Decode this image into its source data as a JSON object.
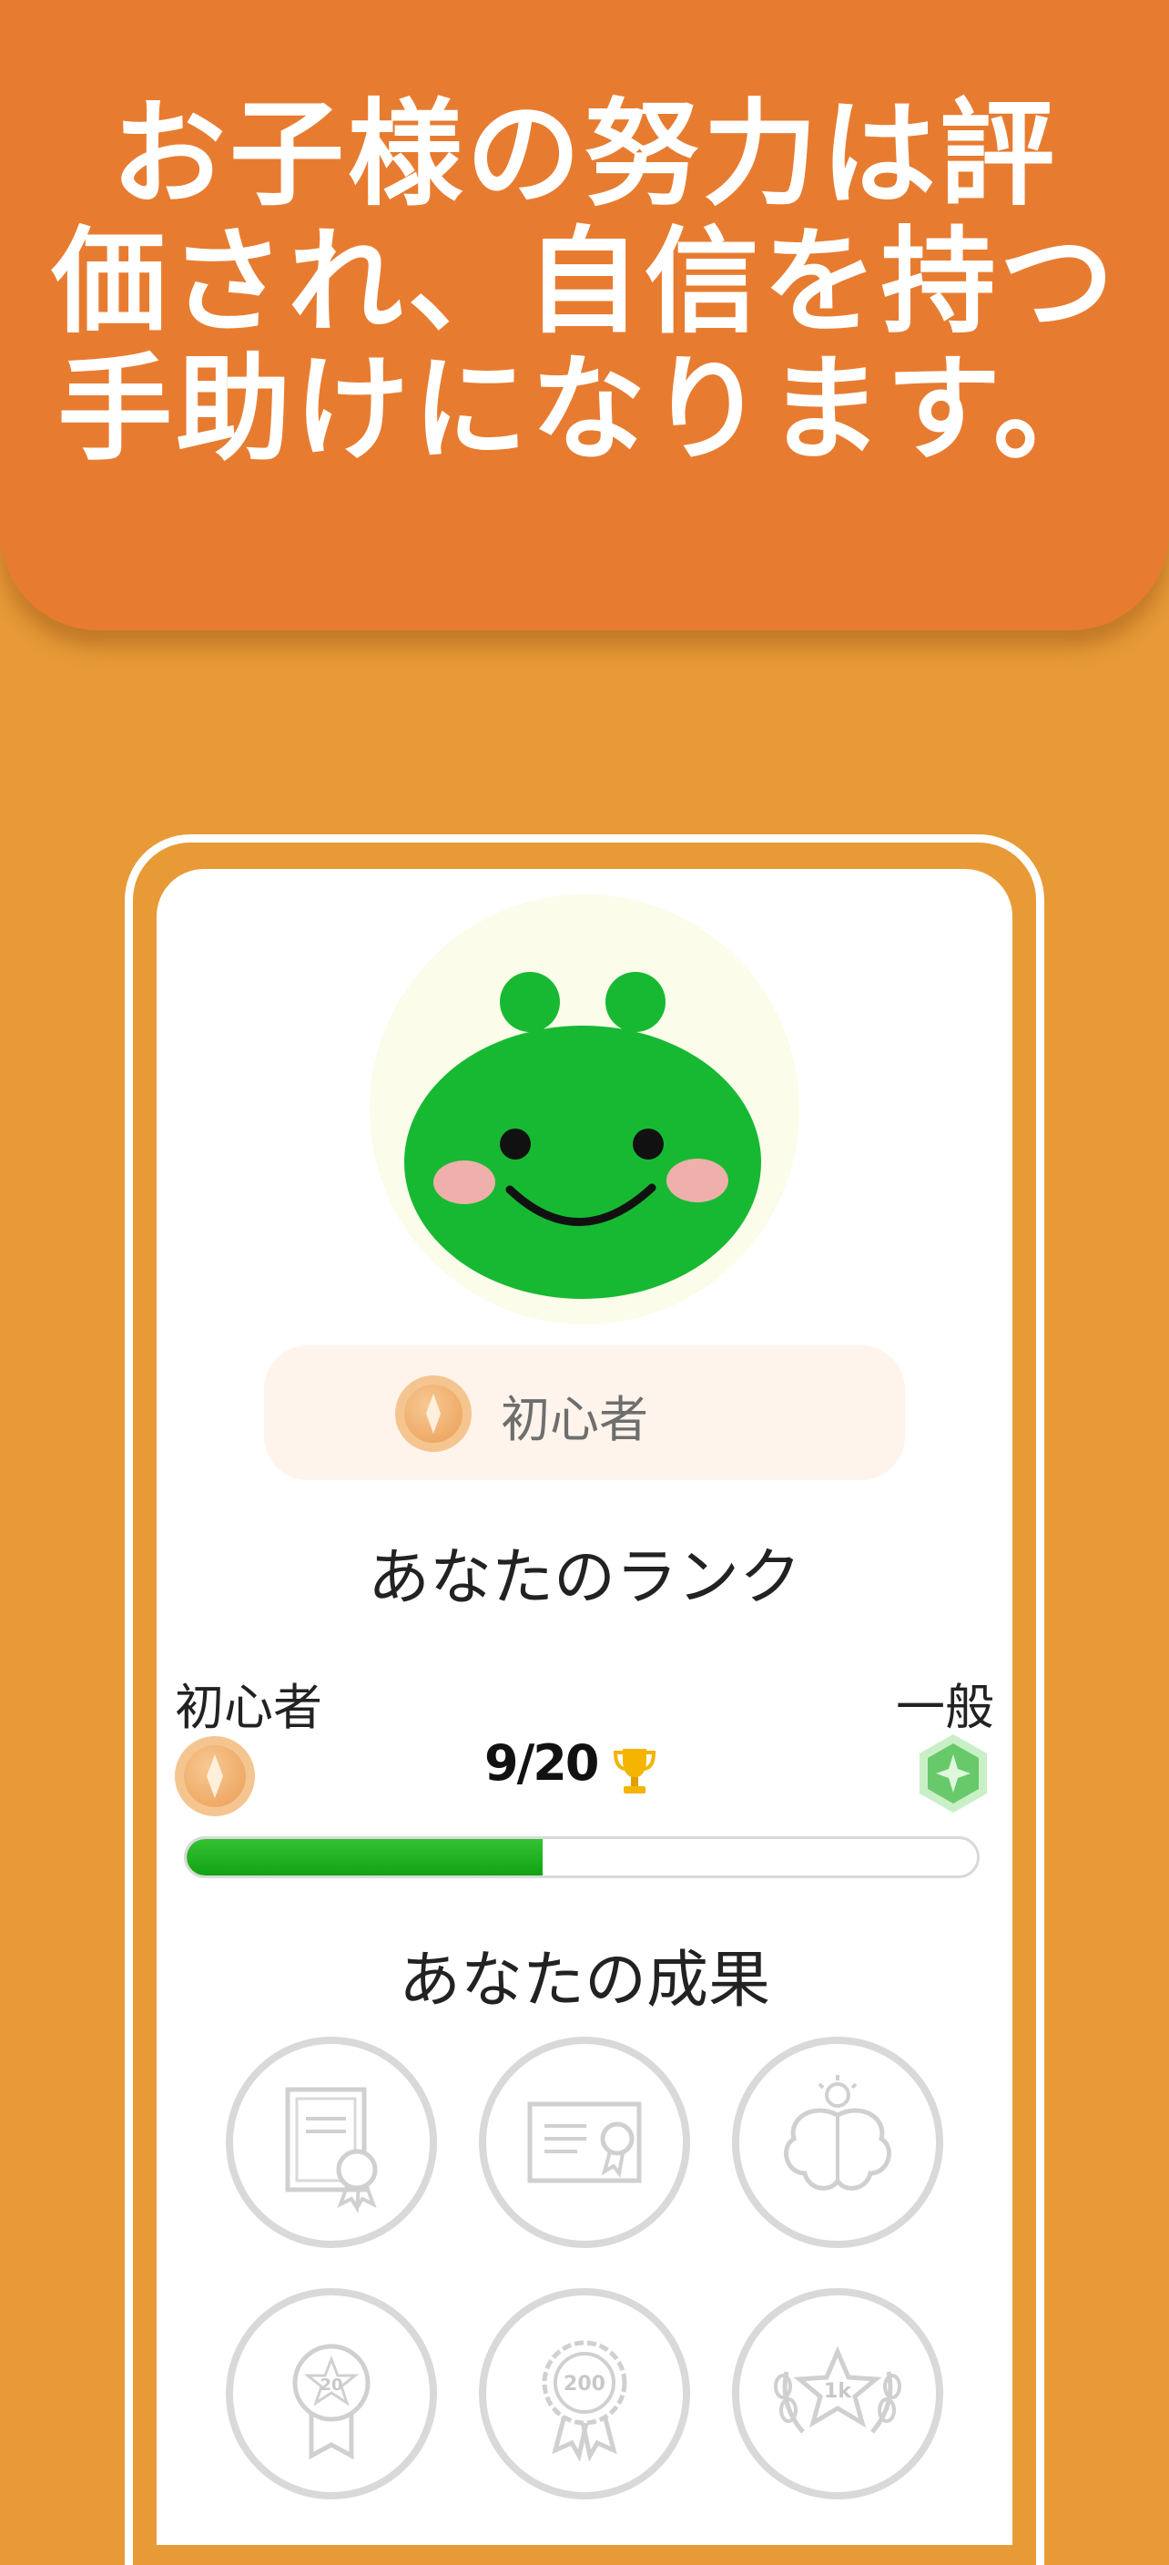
{
  "headline": {
    "lines": [
      "お子様の努力は評",
      "価され、自信を持つ",
      "手助けになります。"
    ]
  },
  "profile": {
    "current_rank_label": "初心者"
  },
  "rank_section": {
    "title": "あなたのランク",
    "current_level": "初心者",
    "next_level": "一般",
    "progress_text": "9/20",
    "progress_current": 9,
    "progress_target": 20,
    "trophy_icon": "trophy-icon"
  },
  "achievements_section": {
    "title": "あなたの成果",
    "badges": [
      {
        "icon": "certificate-icon"
      },
      {
        "icon": "diploma-icon"
      },
      {
        "icon": "brain-idea-icon"
      },
      {
        "icon": "medal-20-icon",
        "label": "20"
      },
      {
        "icon": "rosette-200-icon",
        "label": "200"
      },
      {
        "icon": "laurel-1k-icon",
        "label": "1k"
      }
    ]
  },
  "colors": {
    "background": "#E89A37",
    "headline_card": "#E77C31",
    "mascot": "#17B933",
    "progress": "#1AAE1E"
  }
}
